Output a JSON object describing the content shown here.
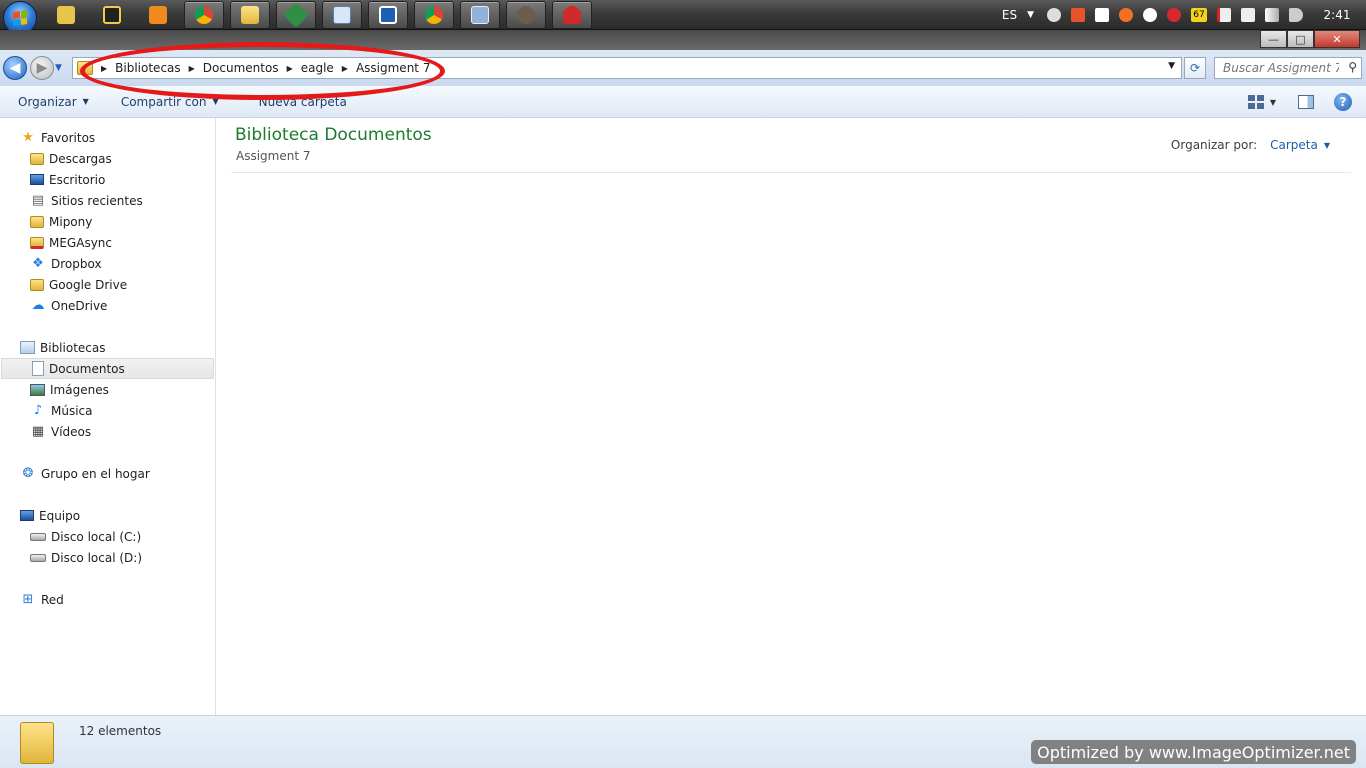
{
  "taskbar": {
    "language": "ES",
    "clock": "2:41",
    "battery_badge": "67",
    "pinned_apps": [
      "chrome-icon",
      "explorer-icon",
      "app-icon",
      "notepad-icon",
      "app-icon",
      "chrome-icon",
      "app-icon",
      "app-icon",
      "app-icon"
    ]
  },
  "window": {
    "minimize": "—",
    "maximize": "□",
    "close": "✕"
  },
  "address": {
    "breadcrumbs": [
      "Bibliotecas",
      "Documentos",
      "eagle",
      "Assigment 7"
    ],
    "search_placeholder": "Buscar Assigment 7"
  },
  "toolbar": {
    "organize": "Organizar",
    "share": "Compartir con",
    "new_folder": "Nueva carpeta"
  },
  "sidebar": {
    "favorites": {
      "label": "Favoritos",
      "items": [
        "Descargas",
        "Escritorio",
        "Sitios recientes",
        "Mipony",
        "MEGAsync",
        "Dropbox",
        "Google Drive",
        "OneDrive"
      ]
    },
    "libraries": {
      "label": "Bibliotecas",
      "items": [
        "Documentos",
        "Imágenes",
        "Música",
        "Vídeos"
      ]
    },
    "homegroup": "Grupo en el hogar",
    "computer": {
      "label": "Equipo",
      "items": [
        "Disco local (C:)",
        "Disco local (D:)"
      ]
    },
    "network": "Red"
  },
  "content": {
    "title": "Biblioteca Documentos",
    "subtitle": "Assigment 7",
    "arrange_label": "Organizar por:",
    "arrange_value": "Carpeta"
  },
  "status": {
    "count": "12 elementos"
  },
  "watermark": "Optimized by www.ImageOptimizer.net",
  "colors": {
    "library_title": "#1e7b2f",
    "annotation": "#e41a1a",
    "link": "#1f5fa8"
  }
}
